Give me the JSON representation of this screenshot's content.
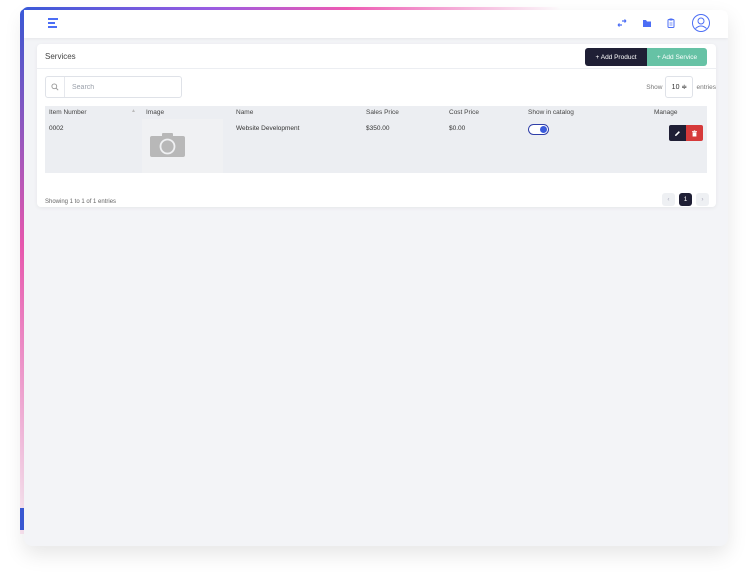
{
  "topbar": {
    "icons": [
      "menu-icon",
      "swap-icon",
      "folder-icon",
      "clipboard-icon",
      "user-avatar-icon"
    ],
    "accent": "#4c6ef5"
  },
  "card": {
    "title": "Services",
    "add_product_label": "+ Add Product",
    "add_service_label": "+ Add Service"
  },
  "search": {
    "placeholder": "Search",
    "value": ""
  },
  "entries": {
    "show_label": "Show",
    "value": "10 ≑",
    "suffix": "entries"
  },
  "table": {
    "headers": [
      "Item Number",
      "Image",
      "Name",
      "Sales Price",
      "Cost Price",
      "Show in catalog",
      "Manage"
    ],
    "rows": [
      {
        "item_number": "0002",
        "image": "camera-placeholder-icon",
        "name": "Website Development",
        "sales_price": "$350.00",
        "cost_price": "$0.00",
        "show_in_catalog": true
      }
    ]
  },
  "footer": {
    "info": "Showing 1 to 1 of 1 entries",
    "prev": "‹",
    "page": "1",
    "next": "›"
  },
  "colors": {
    "dark_button": "#1f1f35",
    "green_button": "#66c2a5",
    "delete_button": "#d63a3a",
    "toggle": "#3b5bdb"
  }
}
